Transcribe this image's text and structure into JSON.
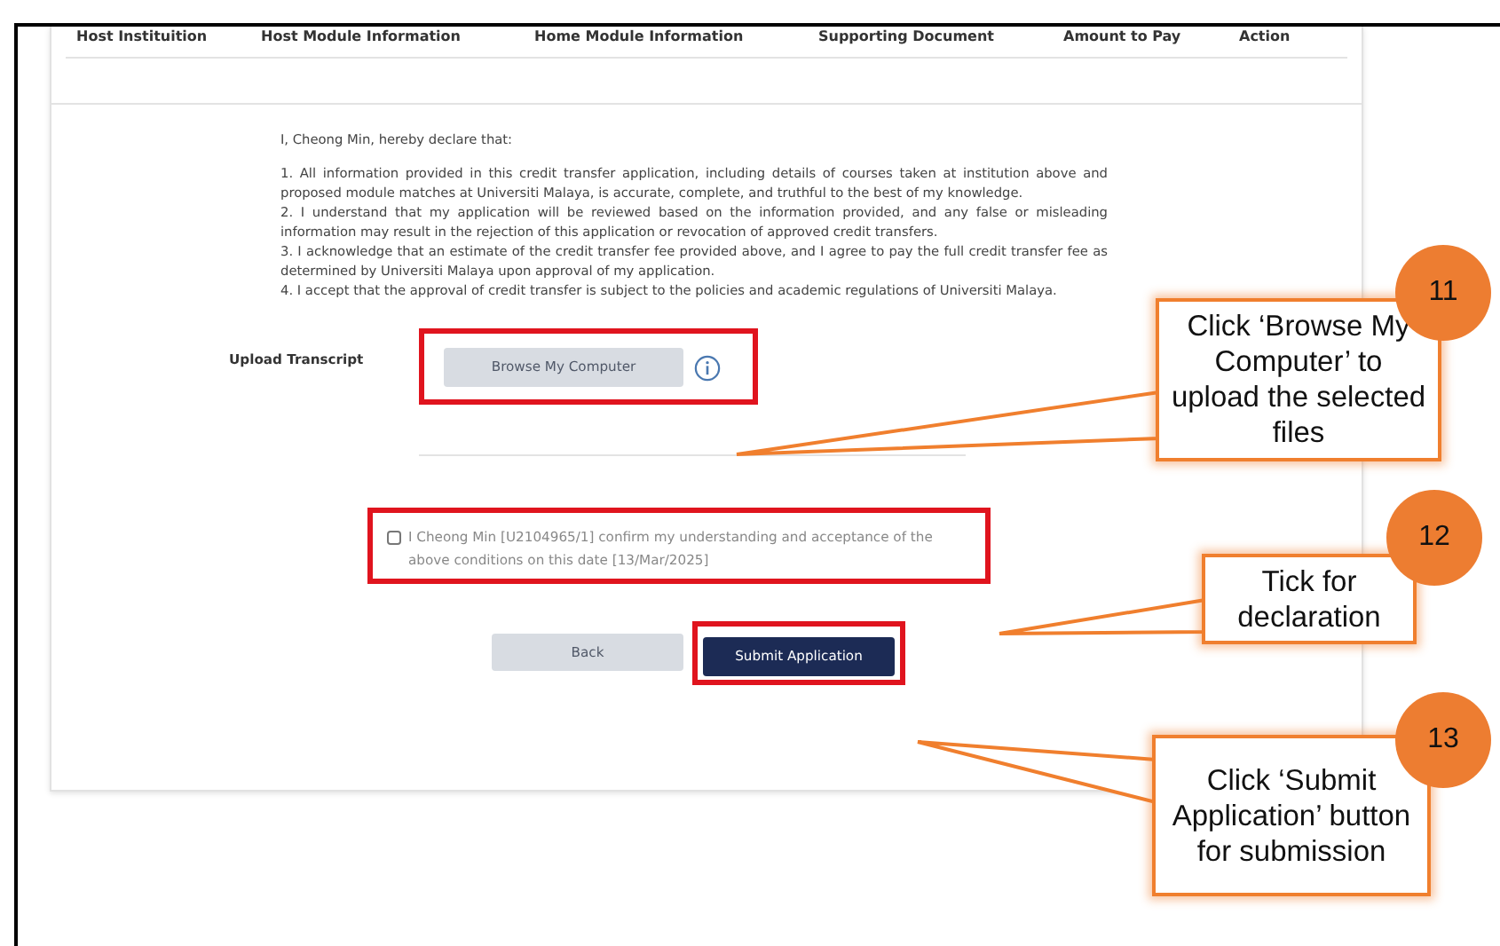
{
  "table_header": {
    "columns": [
      "Host Instituition",
      "Host Module Information",
      "Home Module Information",
      "Supporting Document",
      "Amount to Pay",
      "Action"
    ]
  },
  "declaration": {
    "intro": "I, Cheong Min, hereby declare that:",
    "items": [
      "1. All information provided in this credit transfer application, including details of courses taken at institution above and proposed module matches at Universiti Malaya, is accurate, complete, and truthful to the best of my knowledge.",
      "2. I understand that my application will be reviewed based on the information provided, and any false or misleading information may result in the rejection of this application or revocation of approved credit transfers.",
      "3. I acknowledge that an estimate of the credit transfer fee provided above, and I agree to pay the full credit transfer fee as determined by Universiti Malaya upon approval of my application.",
      "4. I accept that the approval of credit transfer is subject to the policies and academic regulations of Universiti Malaya."
    ]
  },
  "upload": {
    "label": "Upload Transcript",
    "button": "Browse My Computer"
  },
  "confirmation": {
    "label": "I Cheong Min [U2104965/1] confirm my understanding and acceptance of the above conditions on this date [13/Mar/2025]",
    "checked": false
  },
  "buttons": [
    {
      "label": "Back",
      "kind": "secondary"
    },
    {
      "label": "Submit Application",
      "kind": "primary"
    }
  ],
  "callouts": [
    {
      "number": "11",
      "text": "Click ‘Browse My Computer’ to upload the selected files"
    },
    {
      "number": "12",
      "text": "Tick for declaration"
    },
    {
      "number": "13",
      "text": "Click ‘Submit Application’ button for submission"
    }
  ]
}
